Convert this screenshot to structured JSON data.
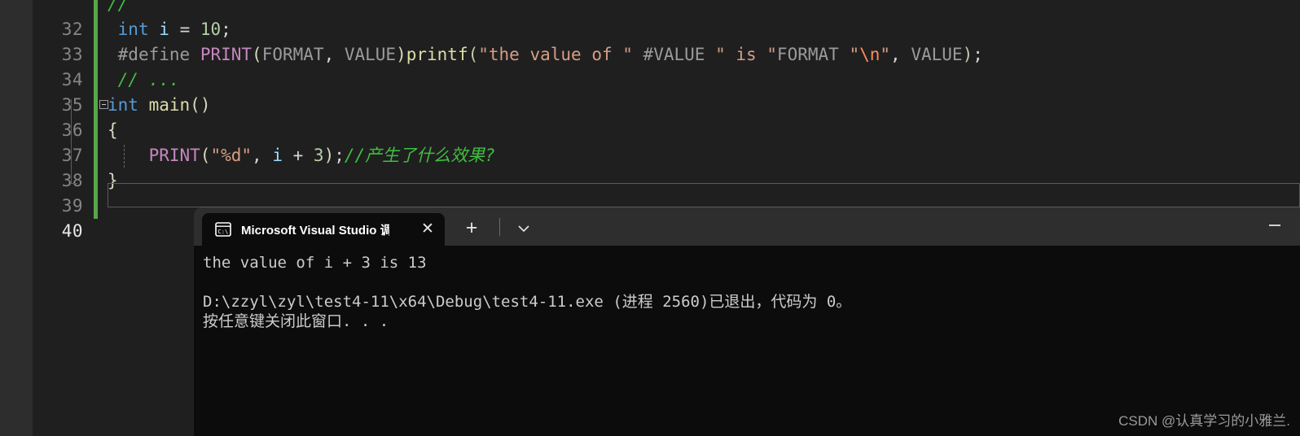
{
  "editor": {
    "theme_bg": "#1f1f1f",
    "change_bar_color": "#57a64a",
    "lines": [
      {
        "number": "32",
        "clipped": true
      },
      {
        "number": "33"
      },
      {
        "number": "34"
      },
      {
        "number": "35"
      },
      {
        "number": "36"
      },
      {
        "number": "37"
      },
      {
        "number": "38"
      },
      {
        "number": "39"
      },
      {
        "number": "40",
        "current": true
      }
    ],
    "code": {
      "line32_fragment": "//",
      "line33": {
        "kw": "int",
        "var": "i",
        "eq": "=",
        "num": "10",
        "semi": ";"
      },
      "line34": {
        "pp": "#define",
        "macro_name": "PRINT",
        "open": "(",
        "p1": "FORMAT",
        "comma": ", ",
        "p2": "VALUE",
        "close": ")",
        "fn": "printf",
        "open2": "(",
        "str1": "\"the value of \"",
        "hashvalue": " #VALUE ",
        "str2": "\" is \"",
        "format": "FORMAT ",
        "str3": "\"",
        "esc": "\\n",
        "str4": "\"",
        "comma2": ", ",
        "arg": "VALUE",
        "close2": ")",
        "semi": ";"
      },
      "line35": "// ...",
      "line36": {
        "kw": "int",
        "fn": "main",
        "parens": "()"
      },
      "line37": "{",
      "line38": {
        "macro": "PRINT",
        "open": "(",
        "str": "\"%d\"",
        "comma": ", ",
        "var": "i",
        "plus": " + ",
        "num": "3",
        "close": ")",
        "semi": ";",
        "comment": "//产生了什么效果?"
      },
      "line39": "}",
      "line40": ""
    }
  },
  "console": {
    "tab_title": "Microsoft Visual Studio 调试控",
    "tab_icon": "terminal-cmd-icon",
    "close_label": "✕",
    "new_tab_label": "+",
    "chevron_label": "chevron-down-icon",
    "minimize_label": "minimize-icon",
    "output": {
      "line1": "the value of i + 3 is 13",
      "line2": "D:\\zzyl\\zyl\\test4-11\\x64\\Debug\\test4-11.exe (进程 2560)已退出，代码为 0。",
      "line3": "按任意键关闭此窗口. . ."
    }
  },
  "watermark": {
    "text": "CSDN @认真学习的小雅兰."
  }
}
